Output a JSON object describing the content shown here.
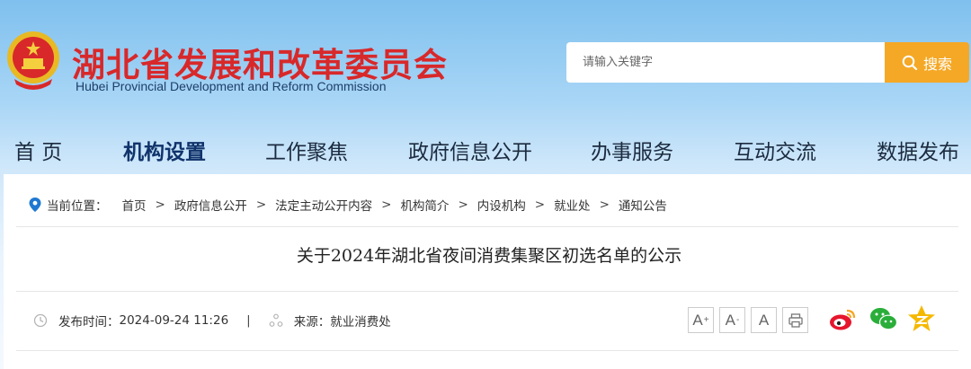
{
  "header": {
    "title_cn": "湖北省发展和改革委员会",
    "title_en": "Hubei Provincial Development and Reform Commission",
    "emblem_icon": "national-emblem-icon"
  },
  "search": {
    "placeholder": "请输入关键字",
    "button_label": "搜索",
    "button_color": "#f5a825"
  },
  "nav": {
    "items": [
      {
        "label": "首 页"
      },
      {
        "label": "机构设置",
        "active": true
      },
      {
        "label": "工作聚焦"
      },
      {
        "label": "政府信息公开"
      },
      {
        "label": "办事服务"
      },
      {
        "label": "互动交流"
      },
      {
        "label": "数据发布"
      }
    ]
  },
  "breadcrumb": {
    "label": "当前位置：",
    "items": [
      "首页",
      "政府信息公开",
      "法定主动公开内容",
      "机构简介",
      "内设机构",
      "就业处",
      "通知公告"
    ],
    "separator": ">"
  },
  "article": {
    "title": "关于2024年湖北省夜间消费集聚区初选名单的公示",
    "publish_label": "发布时间：",
    "publish_time": "2024-09-24 11:26",
    "source_label": "来源：",
    "source": "就业消费处"
  },
  "tools": {
    "font_large": "A",
    "font_medium": "A",
    "font_small": "A",
    "plus": "+",
    "minus": "-"
  },
  "share": [
    "weibo-icon",
    "wechat-icon",
    "qzone-icon"
  ]
}
